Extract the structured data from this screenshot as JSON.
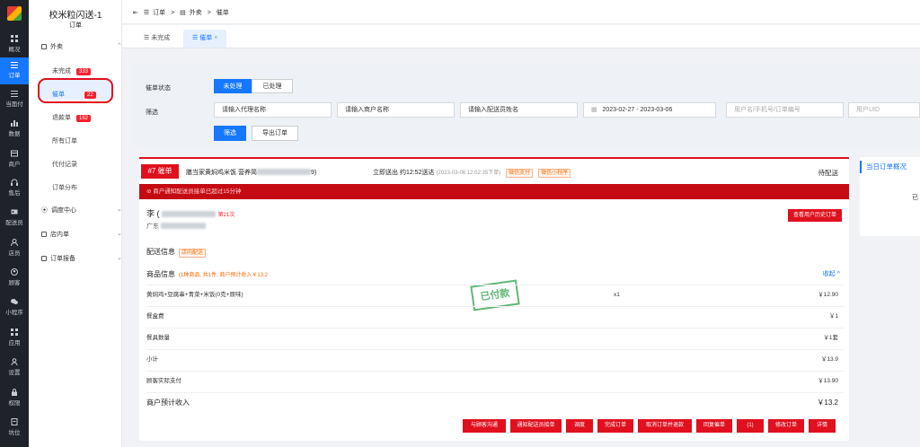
{
  "rail": {
    "items": [
      {
        "label": "概况",
        "icon": "grid-icon"
      },
      {
        "label": "订单",
        "icon": "order-list-icon",
        "active": true
      },
      {
        "label": "当面付",
        "icon": "list-icon"
      },
      {
        "label": "数据",
        "icon": "bar-chart-icon"
      },
      {
        "label": "商户",
        "icon": "store-icon"
      },
      {
        "label": "售后",
        "icon": "headset-icon"
      },
      {
        "label": "配送员",
        "icon": "id-card-icon"
      },
      {
        "label": "店员",
        "icon": "users-icon"
      },
      {
        "label": "顾客",
        "icon": "user-circle-icon"
      },
      {
        "label": "小程序",
        "icon": "chat-icon"
      },
      {
        "label": "应用",
        "icon": "apps-icon"
      },
      {
        "label": "设置",
        "icon": "person-gear-icon"
      },
      {
        "label": "权限",
        "icon": "lock-icon"
      },
      {
        "label": "坑位",
        "icon": "doc-icon"
      }
    ]
  },
  "submenu": {
    "title": "校米粒闪送-1",
    "subtitle": "订单",
    "group_takeout": "外卖",
    "items": [
      {
        "label": "未完成",
        "badge": "333"
      },
      {
        "label": "催单",
        "badge": "22",
        "active": true
      },
      {
        "label": "退款单",
        "badge": "162"
      },
      {
        "label": "所有订单",
        "badge": ""
      },
      {
        "label": "代付记录",
        "badge": ""
      },
      {
        "label": "订单分布",
        "badge": ""
      }
    ],
    "group_dispatch": "调度中心",
    "group_instore": "店内单",
    "group_report": "订单报备"
  },
  "breadcrumb": {
    "a": "订单",
    "sep": ">",
    "b": "外卖",
    "c": "催单"
  },
  "tabs": {
    "unfinished": "未完成",
    "urge": "催单",
    "close": "×"
  },
  "filter": {
    "status_label": "催单状态",
    "status_unhandled": "未处理",
    "status_handled": "已处理",
    "filter_label": "筛选",
    "agent_placeholder": "请输入代理名称",
    "merchant_placeholder": "请输入商户名称",
    "courier_placeholder": "请输入配送员姓名",
    "date_start": "2023-02-27",
    "date_sep": "-",
    "date_end": "2023-03-06",
    "search_placeholder": "用户名/手机号/订单编号",
    "uid_placeholder": "用户UID",
    "filter_button": "筛选",
    "export_button": "导出订单"
  },
  "order": {
    "tag": "#7 催单",
    "shop": "膳当家黄焖鸡米饭.营养简",
    "shop_tail": "9)",
    "deliver_now": "立即送出",
    "eta": "约12:52送达",
    "placed_time": "(2023-03-06 12:02:35下单)",
    "pay_tag": "微信支付",
    "mini_tag": "微信小程序",
    "status": "待配送",
    "alert": "商户通知配送员接单已超过15分钟",
    "customer": "李",
    "customer_suffix": "(",
    "times": "第21次",
    "address": "广东",
    "history_button": "查看用户历史订单",
    "delivery_title": "配送信息",
    "delivery_note": "店内配送",
    "goods_title": "商品信息",
    "goods_note": "(1种商品, 共1件, 商户预计收入￥13.2",
    "collapse": "收起 ^",
    "stamp": "已付款",
    "rows": [
      {
        "label": "黄焖鸡+豆腐串+青菜+米饭(0克+原味)",
        "mid": "x1",
        "value": "￥12.90"
      },
      {
        "label": "餐盒费",
        "mid": "",
        "value": "￥1"
      },
      {
        "label": "餐具数量",
        "mid": "",
        "value": "￥1套"
      },
      {
        "label": "小计",
        "mid": "",
        "value": "￥13.9"
      },
      {
        "label": "顾客实际支付",
        "mid": "",
        "value": "￥13.90"
      }
    ],
    "income_label": "商户预计收入",
    "income_value": "￥13.2",
    "actions": [
      "与顾客沟通",
      "通知配送员接单",
      "调度",
      "完成订单",
      "取消订单并退款",
      "回复催单",
      "(1)",
      "修改订单",
      "详情"
    ]
  },
  "side": {
    "title": "当日订单概况",
    "sub": "已"
  }
}
